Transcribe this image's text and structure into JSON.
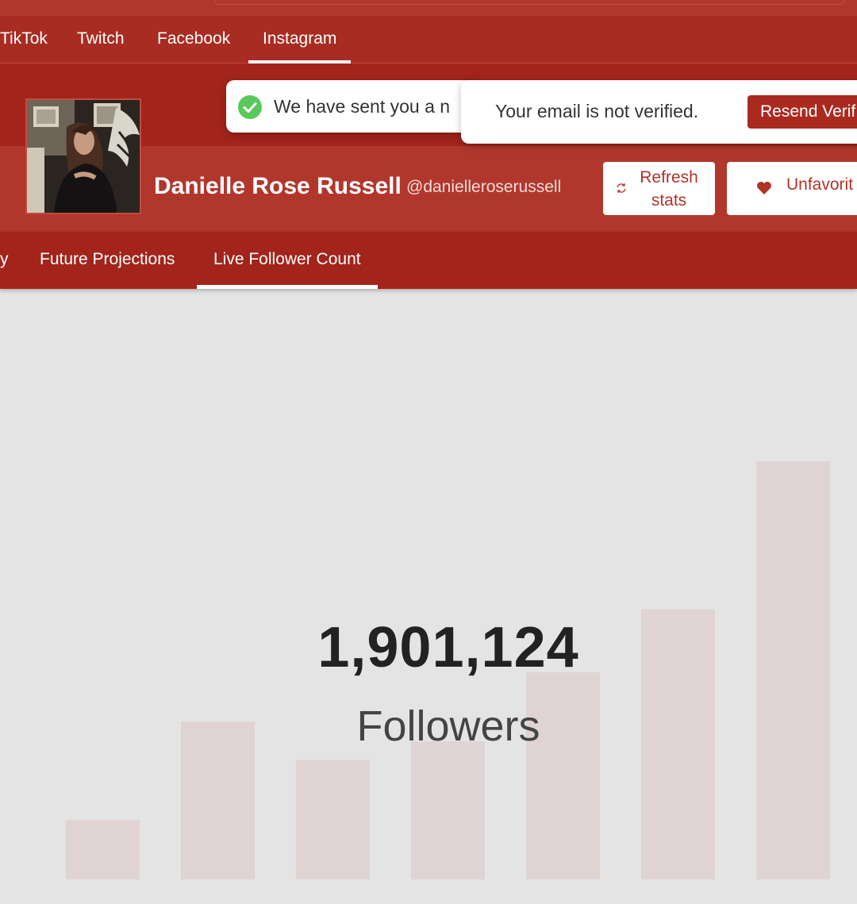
{
  "platform_nav": {
    "tabs": [
      {
        "label": "TikTok",
        "active": false
      },
      {
        "label": "Twitch",
        "active": false
      },
      {
        "label": "Facebook",
        "active": false
      },
      {
        "label": "Instagram",
        "active": true
      }
    ]
  },
  "toasts": {
    "sent_message": "We have sent you a n",
    "verify_message": "Your email is not verified.",
    "resend_label": "Resend Verif"
  },
  "profile": {
    "name": "Danielle Rose Russell",
    "handle": "@danielleroserussell",
    "refresh_label": "Refresh stats",
    "unfavorite_label": "Unfavorit"
  },
  "sub_nav": {
    "tabs": [
      {
        "label": "y",
        "active": false
      },
      {
        "label": "Future Projections",
        "active": false
      },
      {
        "label": "Live Follower Count",
        "active": true
      }
    ]
  },
  "live_count": {
    "value": "1,901,124",
    "label": "Followers"
  },
  "colors": {
    "brand": "#a82c22",
    "accent_button": "#aa2a20",
    "success": "#5ac85a",
    "bar_fill": "#dfd3d3"
  },
  "chart_data": {
    "type": "bar",
    "values": [
      0.142,
      0.377,
      0.286,
      0.33,
      0.495,
      0.646,
      1.0
    ],
    "ylim": [
      0,
      1
    ],
    "grid": false
  }
}
